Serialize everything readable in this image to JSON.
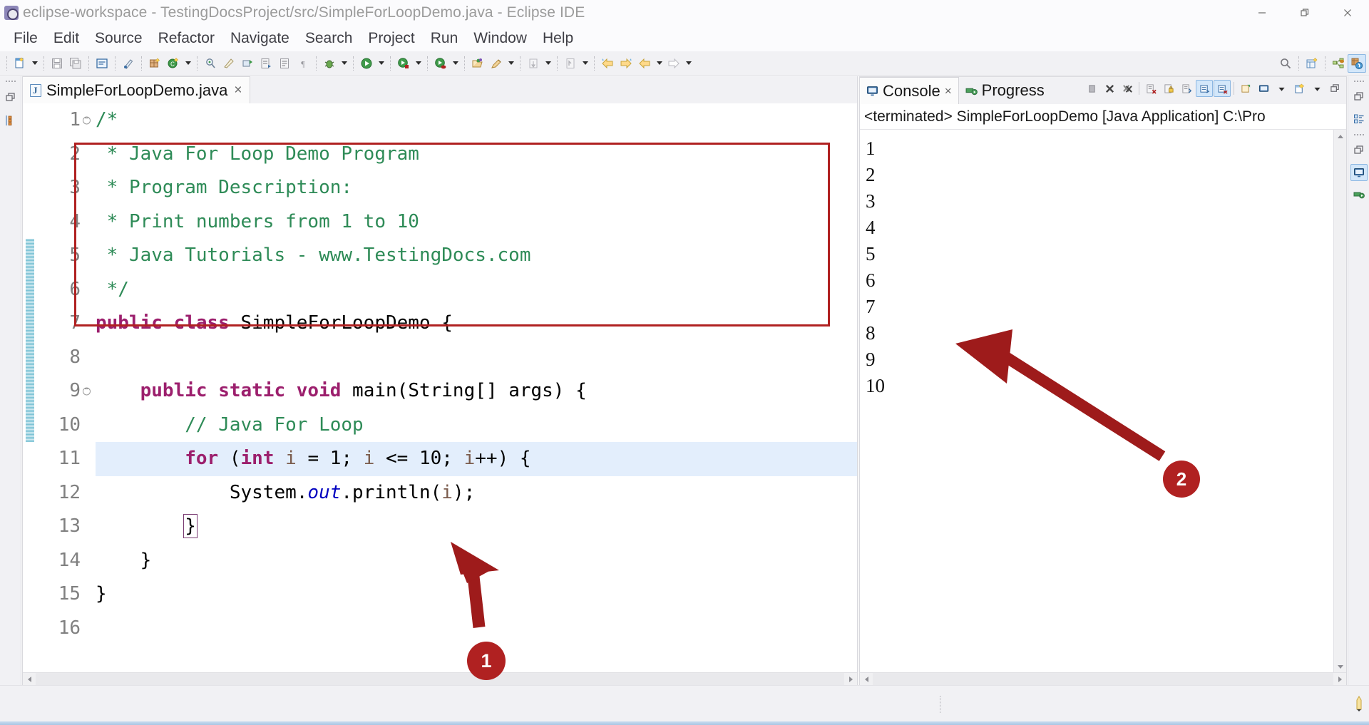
{
  "window": {
    "title": "eclipse-workspace - TestingDocsProject/src/SimpleForLoopDemo.java - Eclipse IDE",
    "app_icon": "eclipse-icon",
    "controls": {
      "minimize": "minimize-button",
      "restore": "restore-button",
      "close": "close-button"
    }
  },
  "menubar": {
    "items": [
      "File",
      "Edit",
      "Source",
      "Refactor",
      "Navigate",
      "Search",
      "Project",
      "Run",
      "Window",
      "Help"
    ]
  },
  "toolbar": {
    "groups": [
      {
        "buttons": [
          {
            "name": "new-wizard",
            "icon": "new-file-icon"
          }
        ],
        "dropdown": true
      },
      {
        "buttons": [
          {
            "name": "save",
            "icon": "save-icon"
          },
          {
            "name": "save-all",
            "icon": "save-all-icon"
          }
        ],
        "dropdown": false
      },
      {
        "buttons": [
          {
            "name": "open-type",
            "icon": "open-type-icon"
          },
          {
            "name": "toggle-mark-occurrences",
            "icon": "pen-icon"
          }
        ],
        "dropdown": false
      },
      {
        "buttons": [
          {
            "name": "new-java-package",
            "icon": "package-icon"
          },
          {
            "name": "new-java-class",
            "icon": "class-icon"
          }
        ],
        "dropdown": true
      },
      {
        "buttons": [
          {
            "name": "search",
            "icon": "search-scope-icon"
          },
          {
            "name": "open-task",
            "icon": "task-icon"
          },
          {
            "name": "skip-breakpoints",
            "icon": "breakpoint-icon"
          },
          {
            "name": "next-annotation",
            "icon": "next-annotation-icon"
          },
          {
            "name": "previous-annotation",
            "icon": "previous-annotation-icon"
          },
          {
            "name": "last-edit-location",
            "icon": "pilcrow-icon"
          }
        ],
        "dropdown": false
      },
      {
        "buttons": [
          {
            "name": "debug",
            "icon": "debug-bug-icon"
          }
        ],
        "dropdown": true
      },
      {
        "buttons": [
          {
            "name": "run",
            "icon": "run-green-icon"
          }
        ],
        "dropdown": true
      },
      {
        "buttons": [
          {
            "name": "coverage",
            "icon": "coverage-icon"
          }
        ],
        "dropdown": true
      },
      {
        "buttons": [
          {
            "name": "profile",
            "icon": "profile-icon"
          }
        ],
        "dropdown": true
      },
      {
        "buttons": [
          {
            "name": "open-perspective",
            "icon": "perspective-icon"
          },
          {
            "name": "edit-annotation",
            "icon": "highlighter-icon"
          }
        ],
        "dropdown": true
      },
      {
        "buttons": [
          {
            "name": "external-tools",
            "icon": "external-tools-icon"
          }
        ],
        "dropdown": true
      },
      {
        "buttons": [
          {
            "name": "open-declaration",
            "icon": "declaration-icon"
          }
        ],
        "dropdown": true
      },
      {
        "buttons": [
          {
            "name": "back",
            "icon": "back-arrow-icon"
          },
          {
            "name": "forward",
            "icon": "forward-arrow-icon"
          },
          {
            "name": "previous",
            "icon": "prev-arrow-icon"
          }
        ],
        "dropdown": true
      },
      {
        "buttons": [
          {
            "name": "next",
            "icon": "next-arrow-icon"
          }
        ],
        "dropdown": true
      }
    ],
    "right": [
      {
        "name": "quick-access",
        "icon": "search-icon"
      },
      {
        "name": "open-perspective",
        "icon": "open-perspective-icon"
      },
      {
        "name": "perspective-java-ee",
        "icon": "java-ee-perspective-icon"
      },
      {
        "name": "perspective-java",
        "icon": "java-perspective-icon",
        "selected": true
      }
    ]
  },
  "left_trim": {
    "items": [
      {
        "name": "restore-view",
        "icon": "restore-icon"
      },
      {
        "name": "package-explorer",
        "icon": "package-explorer-icon"
      }
    ]
  },
  "right_trim": {
    "items": [
      {
        "name": "restore-view",
        "icon": "restore-icon"
      },
      {
        "name": "outline-view",
        "icon": "outline-icon"
      },
      {
        "name": "restore-view-2",
        "icon": "restore-icon"
      },
      {
        "name": "console-view",
        "icon": "console-icon",
        "selected": true
      },
      {
        "name": "progress-view",
        "icon": "progress-icon"
      }
    ]
  },
  "editor": {
    "tab": {
      "label": "SimpleForLoopDemo.java",
      "icon": "java-file-icon",
      "close": "×"
    },
    "lines": [
      {
        "n": "1",
        "fold": true,
        "tokens": [
          {
            "t": "/*",
            "c": "cm"
          }
        ]
      },
      {
        "n": "2",
        "fold": false,
        "tokens": [
          {
            "t": " * Java For Loop Demo Program",
            "c": "cm"
          }
        ]
      },
      {
        "n": "3",
        "fold": false,
        "tokens": [
          {
            "t": " * Program Description:",
            "c": "cm"
          }
        ]
      },
      {
        "n": "4",
        "fold": false,
        "tokens": [
          {
            "t": " * Print numbers from 1 to 10",
            "c": "cm"
          }
        ]
      },
      {
        "n": "5",
        "fold": false,
        "tokens": [
          {
            "t": " * Java Tutorials - www.TestingDocs.com",
            "c": "cm"
          }
        ]
      },
      {
        "n": "6",
        "fold": false,
        "tokens": [
          {
            "t": " */",
            "c": "cm"
          }
        ]
      },
      {
        "n": "7",
        "fold": false,
        "tokens": [
          {
            "t": "public class ",
            "c": "k"
          },
          {
            "t": "SimpleForLoopDemo {",
            "c": "pl"
          }
        ]
      },
      {
        "n": "8",
        "fold": false,
        "tokens": [
          {
            "t": "",
            "c": "pl"
          }
        ]
      },
      {
        "n": "9",
        "fold": true,
        "tokens": [
          {
            "t": "    ",
            "c": "pl"
          },
          {
            "t": "public static void ",
            "c": "k"
          },
          {
            "t": "main(String[] args) {",
            "c": "pl"
          }
        ]
      },
      {
        "n": "10",
        "fold": false,
        "tokens": [
          {
            "t": "        ",
            "c": "pl"
          },
          {
            "t": "// Java For Loop",
            "c": "cm"
          }
        ]
      },
      {
        "n": "11",
        "fold": false,
        "highlight": true,
        "tokens": [
          {
            "t": "        ",
            "c": "pl"
          },
          {
            "t": "for ",
            "c": "k"
          },
          {
            "t": "(",
            "c": "pl"
          },
          {
            "t": "int ",
            "c": "k"
          },
          {
            "t": "i",
            "c": "lv"
          },
          {
            "t": " = 1; ",
            "c": "pl"
          },
          {
            "t": "i",
            "c": "lv"
          },
          {
            "t": " <= 10; ",
            "c": "pl"
          },
          {
            "t": "i",
            "c": "lv"
          },
          {
            "t": "++) {",
            "c": "pl"
          }
        ]
      },
      {
        "n": "12",
        "fold": false,
        "tokens": [
          {
            "t": "            System.",
            "c": "pl"
          },
          {
            "t": "out",
            "c": "fld"
          },
          {
            "t": ".println(",
            "c": "pl"
          },
          {
            "t": "i",
            "c": "lv"
          },
          {
            "t": ");",
            "c": "pl"
          }
        ]
      },
      {
        "n": "13",
        "fold": false,
        "tokens": [
          {
            "t": "        ",
            "c": "pl"
          },
          {
            "t": "}",
            "c": "pl",
            "boxed": true
          }
        ]
      },
      {
        "n": "14",
        "fold": false,
        "tokens": [
          {
            "t": "    }",
            "c": "pl"
          }
        ]
      },
      {
        "n": "15",
        "fold": false,
        "tokens": [
          {
            "t": "}",
            "c": "pl"
          }
        ]
      },
      {
        "n": "16",
        "fold": false,
        "tokens": [
          {
            "t": "",
            "c": "pl"
          }
        ]
      }
    ],
    "scrollbar": {
      "left_arrow": "scroll-left",
      "right_arrow": "scroll-right"
    }
  },
  "console": {
    "tabs": [
      {
        "label": "Console",
        "icon": "console-icon",
        "active": true,
        "close": "×"
      },
      {
        "label": "Progress",
        "icon": "progress-icon",
        "active": false
      }
    ],
    "tools": [
      {
        "name": "terminate",
        "icon": "terminate-icon"
      },
      {
        "name": "remove-launch",
        "icon": "remove-icon"
      },
      {
        "name": "remove-all-terminated",
        "icon": "remove-all-icon"
      },
      {
        "name": "clear-console",
        "icon": "clear-console-icon"
      },
      {
        "name": "lock-scroll",
        "icon": "lock-scroll-icon"
      },
      {
        "name": "show-console-on-output",
        "icon": "show-on-output-icon"
      },
      {
        "name": "scroll-lock",
        "icon": "scroll-lock-icon",
        "toggled": true
      },
      {
        "name": "word-wrap",
        "icon": "word-wrap-icon",
        "toggled": true
      },
      {
        "name": "pin-console",
        "icon": "pin-icon"
      },
      {
        "name": "display-selected-console",
        "icon": "display-console-icon"
      },
      {
        "name": "open-console",
        "icon": "open-console-icon"
      },
      {
        "name": "view-menu",
        "icon": "view-menu-icon"
      },
      {
        "name": "minimize-view",
        "icon": "minimize-view-icon"
      }
    ],
    "launch_line": "<terminated> SimpleForLoopDemo [Java Application] C:\\Pro",
    "output": [
      "1",
      "2",
      "3",
      "4",
      "5",
      "6",
      "7",
      "8",
      "9",
      "10"
    ],
    "scrollbar": {
      "up_arrow": "scroll-up",
      "down_arrow": "scroll-down",
      "left_arrow": "scroll-left",
      "right_arrow": "scroll-right"
    }
  },
  "annotations": {
    "accent_color": "#b02121",
    "markers": [
      {
        "label": "1",
        "target": "for-loop-code-block"
      },
      {
        "label": "2",
        "target": "console-output"
      }
    ],
    "highlight_box": {
      "target": "for-loop-code-block"
    }
  },
  "statusbar": {
    "writable_indicator": "writable-icon"
  }
}
